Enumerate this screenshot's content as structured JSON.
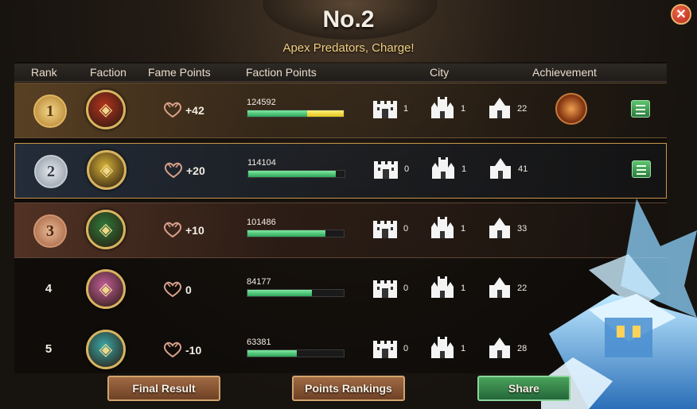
{
  "title": "No.2",
  "subtitle": "Apex Predators, Charge!",
  "headers": {
    "rank": "Rank",
    "faction": "Faction",
    "fame": "Fame Points",
    "faction_points": "Faction Points",
    "city": "City",
    "achievement": "Achievement"
  },
  "rows": [
    {
      "rank": "1",
      "badge": "gold",
      "faction_icon": "lion-icon",
      "faction_color": "#b4331f",
      "fame": "+42",
      "points": "124592",
      "points_fraction_green": 0.62,
      "points_fraction_yellow": 0.38,
      "city1": "1",
      "city2": "1",
      "city3": "22",
      "achievement": true,
      "list": true
    },
    {
      "rank": "2",
      "badge": "silver",
      "faction_icon": "wolf-icon",
      "faction_color": "#d6b238",
      "fame": "+20",
      "points": "114104",
      "points_fraction_green": 0.91,
      "points_fraction_yellow": 0,
      "city1": "0",
      "city2": "1",
      "city3": "41",
      "achievement": false,
      "list": true
    },
    {
      "rank": "3",
      "badge": "bronze",
      "faction_icon": "skull-icon",
      "faction_color": "#2f7a3a",
      "fame": "+10",
      "points": "101486",
      "points_fraction_green": 0.81,
      "points_fraction_yellow": 0,
      "city1": "0",
      "city2": "1",
      "city3": "33",
      "achievement": false,
      "list": false
    },
    {
      "rank": "4",
      "badge": "none",
      "faction_icon": "dragon-icon",
      "faction_color": "#c25e9a",
      "fame": "0",
      "points": "84177",
      "points_fraction_green": 0.67,
      "points_fraction_yellow": 0,
      "city1": "0",
      "city2": "1",
      "city3": "22",
      "achievement": false,
      "list": false
    },
    {
      "rank": "5",
      "badge": "none",
      "faction_icon": "kraken-icon",
      "faction_color": "#3aa8a8",
      "fame": "-10",
      "points": "63381",
      "points_fraction_green": 0.51,
      "points_fraction_yellow": 0,
      "city1": "0",
      "city2": "1",
      "city3": "28",
      "achievement": false,
      "list": false
    }
  ],
  "buttons": {
    "final_result": "Final Result",
    "points_rankings": "Points Rankings",
    "share": "Share"
  },
  "colors": {
    "accent_gold": "#f2cf82",
    "bar_green": "#2ea65a",
    "bar_yellow": "#e0c41a",
    "close_red": "#c93a24"
  }
}
